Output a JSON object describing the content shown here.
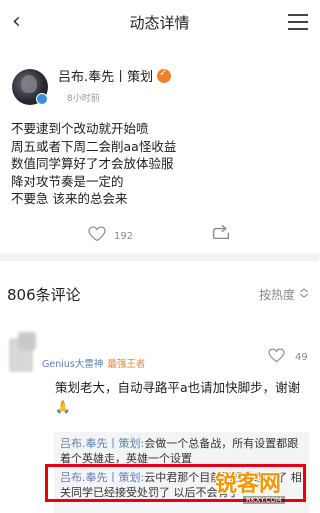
{
  "header": {
    "title": "动态详情"
  },
  "post": {
    "author": "吕布.奉先丨策划",
    "time": "8小时前",
    "lines": [
      "不要逮到个改动就开始喷",
      "周五或者下周二会削aa怪收益",
      "数值同学算好了才会放体验服",
      "降对攻节奏是一定的",
      "不要急 该来的总会来"
    ],
    "like_count": "192"
  },
  "comments": {
    "count_label": "806条评论",
    "sort_label": "按热度",
    "item": {
      "user": "Genius大雷神",
      "badge": "最强王者",
      "like_count": "49",
      "text": "策划老大，自动寻路平a也请加快脚步，谢谢🙏",
      "replies": [
        {
          "name": "吕布.奉先丨策划:",
          "text": "会做一个总备战，所有设置都跟着个英雄走，英雄一个设置"
        },
        {
          "name": "吕布.奉先丨策划:",
          "text": "云中君那个目前已经处理过了 相关同学已经接受处罚了 以后不会有了"
        }
      ]
    }
  },
  "watermark": {
    "main": "锐客网",
    "sub": "RKXY.COM"
  },
  "colors": {
    "link": "#5a80b8",
    "highlight": "#e60012",
    "watermark": "#f39800"
  }
}
